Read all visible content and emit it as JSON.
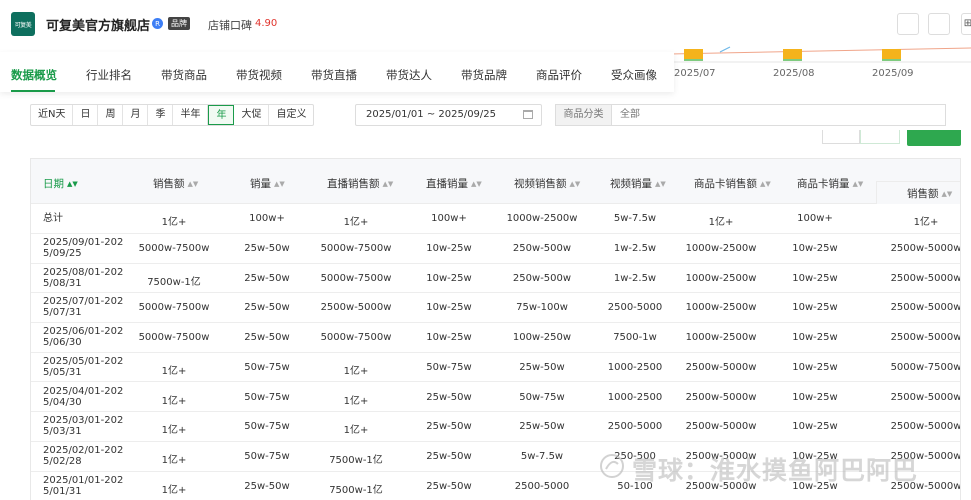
{
  "header": {
    "logo_text": "可复美",
    "store_name": "可复美官方旗舰店",
    "verified_mark": "R",
    "brand_badge": "品牌",
    "reputation_label": "店铺口碑",
    "reputation_score": "4.90",
    "more_icon": "⊞"
  },
  "chart_strip": {
    "labels": [
      "2025/07",
      "2025/08",
      "2025/09"
    ]
  },
  "nav": {
    "tabs": [
      "数据概览",
      "行业排名",
      "带货商品",
      "带货视频",
      "带货直播",
      "带货达人",
      "带货品牌",
      "商品评价",
      "受众画像"
    ],
    "active": 0
  },
  "filters": {
    "periods": [
      "近N天",
      "日",
      "周",
      "月",
      "季",
      "半年",
      "年",
      "大促",
      "自定义"
    ],
    "active_period": "年",
    "date_range": "2025/01/01 ~ 2025/09/25",
    "category_label": "商品分类",
    "category_value": "全部"
  },
  "table": {
    "headers": [
      "日期",
      "销售额",
      "销量",
      "直播销售额",
      "直播销量",
      "视频销售额",
      "视频销量",
      "商品卡销售额",
      "商品卡销量",
      "销售额"
    ],
    "total": [
      "总计",
      "1亿+",
      "100w+",
      "1亿+",
      "100w+",
      "1000w-2500w",
      "5w-7.5w",
      "1亿+",
      "100w+",
      "1亿+"
    ],
    "rows": [
      [
        "2025/09/01-2025/09/25",
        "5000w-7500w",
        "25w-50w",
        "5000w-7500w",
        "10w-25w",
        "250w-500w",
        "1w-2.5w",
        "1000w-2500w",
        "10w-25w",
        "2500w-5000w"
      ],
      [
        "2025/08/01-2025/08/31",
        "7500w-1亿",
        "25w-50w",
        "5000w-7500w",
        "10w-25w",
        "250w-500w",
        "1w-2.5w",
        "1000w-2500w",
        "10w-25w",
        "2500w-5000w"
      ],
      [
        "2025/07/01-2025/07/31",
        "5000w-7500w",
        "25w-50w",
        "2500w-5000w",
        "10w-25w",
        "75w-100w",
        "2500-5000",
        "1000w-2500w",
        "10w-25w",
        "2500w-5000w"
      ],
      [
        "2025/06/01-2025/06/30",
        "5000w-7500w",
        "25w-50w",
        "5000w-7500w",
        "10w-25w",
        "100w-250w",
        "7500-1w",
        "1000w-2500w",
        "10w-25w",
        "2500w-5000w"
      ],
      [
        "2025/05/01-2025/05/31",
        "1亿+",
        "50w-75w",
        "1亿+",
        "50w-75w",
        "25w-50w",
        "1000-2500",
        "2500w-5000w",
        "10w-25w",
        "5000w-7500w"
      ],
      [
        "2025/04/01-2025/04/30",
        "1亿+",
        "50w-75w",
        "1亿+",
        "25w-50w",
        "50w-75w",
        "1000-2500",
        "2500w-5000w",
        "10w-25w",
        "2500w-5000w"
      ],
      [
        "2025/03/01-2025/03/31",
        "1亿+",
        "50w-75w",
        "1亿+",
        "25w-50w",
        "25w-50w",
        "2500-5000",
        "2500w-5000w",
        "10w-25w",
        "2500w-5000w"
      ],
      [
        "2025/02/01-2025/02/28",
        "1亿+",
        "50w-75w",
        "7500w-1亿",
        "25w-50w",
        "5w-7.5w",
        "250-500",
        "2500w-5000w",
        "10w-25w",
        "2500w-5000w"
      ],
      [
        "2025/01/01-2025/01/31",
        "1亿+",
        "25w-50w",
        "7500w-1亿",
        "25w-50w",
        "2500-5000",
        "50-100",
        "2500w-5000w",
        "10w-25w",
        "2500w-5000w"
      ]
    ]
  },
  "watermark": "雪球：淮水摸鱼阿巴阿巴",
  "colors": {
    "accent": "#1a9b4a",
    "score": "#e0332c",
    "chart_bar": "#f5b31b"
  }
}
